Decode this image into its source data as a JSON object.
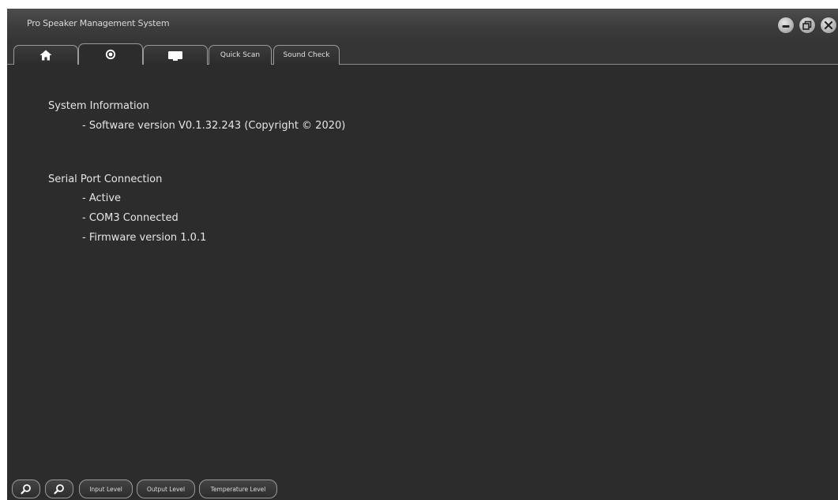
{
  "window": {
    "title": "Pro Speaker Management System"
  },
  "window_controls": [
    {
      "name": "minimize",
      "icon": "minimize-icon"
    },
    {
      "name": "restore",
      "icon": "restore-icon"
    },
    {
      "name": "close",
      "icon": "close-icon"
    }
  ],
  "tabs": [
    {
      "id": "home",
      "icon": "home-icon",
      "label": ""
    },
    {
      "id": "settings",
      "icon": "settings-icon",
      "label": "",
      "active": true
    },
    {
      "id": "display",
      "icon": "monitor-icon",
      "label": ""
    },
    {
      "id": "quick-scan",
      "label": "Quick Scan"
    },
    {
      "id": "sound-check",
      "label": "Sound Check"
    }
  ],
  "system_info": {
    "heading": "System Information",
    "software_version": "- Software version V0.1.32.243 (Copyright ©  2020)"
  },
  "serial_port": {
    "heading": "Serial Port Connection",
    "status": "- Active",
    "port": "- COM3 Connected",
    "firmware": "- Firmware version 1.0.1"
  },
  "bottom_bar": {
    "zoom_in_icon": "zoom-in-icon",
    "zoom_out_icon": "zoom-out-icon",
    "input_level": "Input Level",
    "output_level": "Output Level",
    "temperature_level": "Temperature Level"
  },
  "colors": {
    "background": "#2c2c2c",
    "titlebar": "#3c3c3c",
    "text": "#e6e6e6",
    "border": "#9a9a9a"
  }
}
